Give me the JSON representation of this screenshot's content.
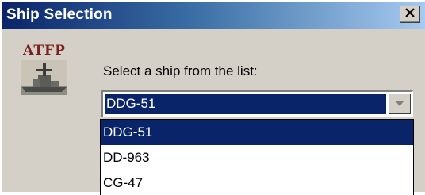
{
  "window": {
    "title": "Ship Selection",
    "close_label": "×"
  },
  "logo": {
    "text": "ATFP"
  },
  "form": {
    "prompt": "Select a ship from the list:",
    "selected_value": "DDG-51"
  },
  "dropdown": {
    "options": [
      "DDG-51",
      "DD-963",
      "CG-47"
    ],
    "highlighted": "DDG-51"
  },
  "colors": {
    "title_start": "#0a246a",
    "title_end": "#a6caf0",
    "selection": "#0a246a",
    "face": "#d4d0c8",
    "logo_text": "#7a2020"
  },
  "icons": [
    "close-icon",
    "chevron-down-icon",
    "ship-logo-icon"
  ]
}
